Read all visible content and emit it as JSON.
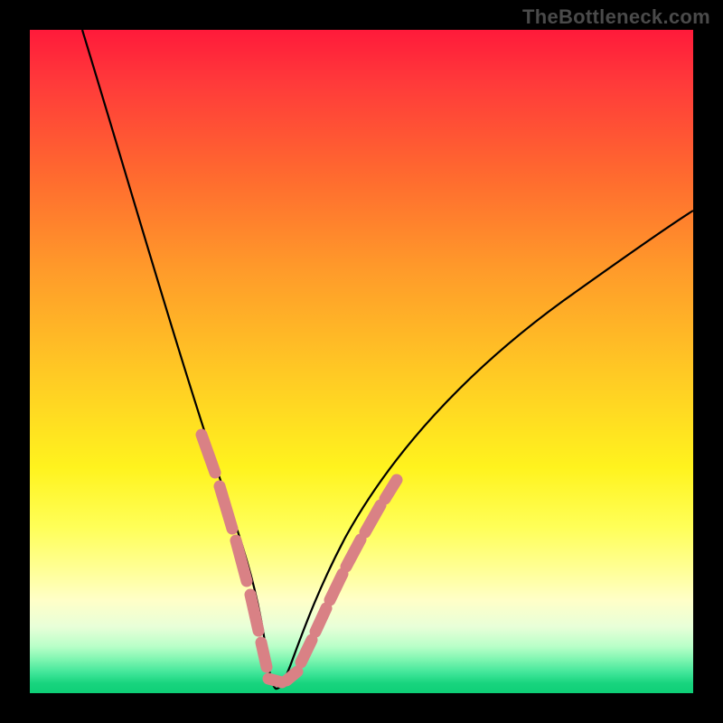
{
  "watermark": "TheBottleneck.com",
  "chart_data": {
    "type": "line",
    "title": "",
    "xlabel": "",
    "ylabel": "",
    "xlim": [
      0,
      100
    ],
    "ylim": [
      0,
      100
    ],
    "grid": false,
    "legend": false,
    "series": [
      {
        "name": "bottleneck-curve",
        "color": "#000000",
        "x": [
          8,
          12,
          16,
          20,
          24,
          27,
          30,
          32,
          34,
          35,
          36,
          37,
          38,
          40,
          42,
          44,
          48,
          55,
          63,
          72,
          82,
          92,
          100
        ],
        "y": [
          100,
          88,
          72,
          56,
          40,
          28,
          17,
          10,
          5,
          2,
          0.5,
          0.5,
          1.5,
          4,
          8,
          12,
          19,
          29,
          38,
          46,
          53,
          59,
          64
        ]
      },
      {
        "name": "highlight-segments-left",
        "color": "#d98185",
        "segments": [
          {
            "x": [
              23.5,
              26.5
            ],
            "y": [
              42,
              30
            ]
          },
          {
            "x": [
              27.0,
              30.0
            ],
            "y": [
              28,
              17
            ]
          },
          {
            "x": [
              30.5,
              32.5
            ],
            "y": [
              15,
              8
            ]
          },
          {
            "x": [
              33.0,
              34.5
            ],
            "y": [
              6.5,
              2.5
            ]
          }
        ]
      },
      {
        "name": "highlight-segments-bottom",
        "color": "#d98185",
        "segments": [
          {
            "x": [
              34.8,
              37.5
            ],
            "y": [
              1.2,
              1.0
            ]
          },
          {
            "x": [
              38.0,
              39.5
            ],
            "y": [
              1.5,
              3.5
            ]
          }
        ]
      },
      {
        "name": "highlight-segments-right",
        "color": "#d98185",
        "segments": [
          {
            "x": [
              40.0,
              42.0
            ],
            "y": [
              4.5,
              8.5
            ]
          },
          {
            "x": [
              42.5,
              44.5
            ],
            "y": [
              9.5,
              13
            ]
          },
          {
            "x": [
              45.0,
              47.5
            ],
            "y": [
              14,
              18.5
            ]
          },
          {
            "x": [
              48.0,
              50.5
            ],
            "y": [
              19.5,
              23.5
            ]
          },
          {
            "x": [
              51.0,
              53.5
            ],
            "y": [
              24.5,
              28
            ]
          }
        ]
      }
    ],
    "background_gradient": {
      "top": "#ff1a3a",
      "mid": "#fff31e",
      "bottom": "#0ecf77"
    }
  }
}
